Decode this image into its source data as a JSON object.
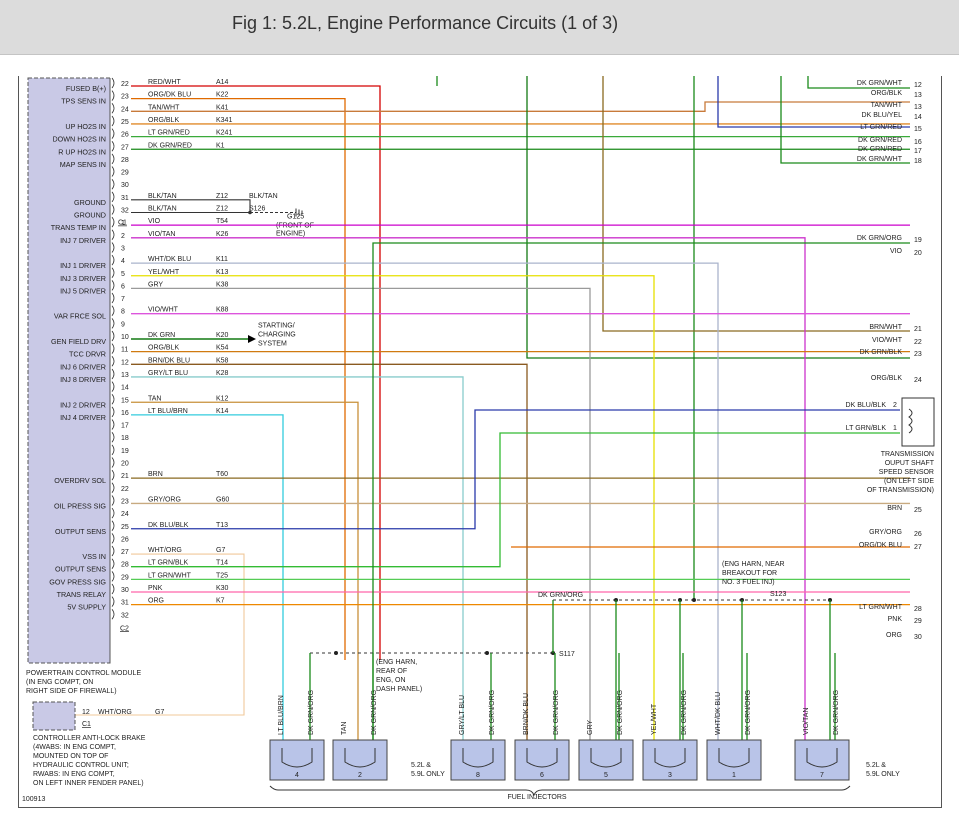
{
  "title": "Fig 1: 5.2L, Engine Performance Circuits (1 of 3)",
  "pcm": {
    "connector": "C2",
    "label_lines": [
      "POWERTRAIN CONTROL MODULE",
      "(IN ENG COMPT, ON",
      "RIGHT SIDE OF FIREWALL)"
    ],
    "functions": [
      {
        "name": "FUSED B(+)",
        "pin": 22
      },
      {
        "name": "TPS SENS IN",
        "pin": 23
      },
      {
        "name": "UP HO2S IN",
        "pin": 25
      },
      {
        "name": "DOWN HO2S IN",
        "pin": 26
      },
      {
        "name": "R UP HO2S IN",
        "pin": 27
      },
      {
        "name": "MAP SENS IN",
        "pin": 28
      },
      {
        "name": "GROUND",
        "pin": 31
      },
      {
        "name": "GROUND",
        "pin": 32
      },
      {
        "name": "TRANS TEMP IN",
        "pin": 1
      },
      {
        "name": "INJ 7 DRIVER",
        "pin": 2
      },
      {
        "name": "INJ 1 DRIVER",
        "pin": 4
      },
      {
        "name": "INJ 3 DRIVER",
        "pin": 5
      },
      {
        "name": "INJ 5 DRIVER",
        "pin": 6
      },
      {
        "name": "VAR FRCE SOL",
        "pin": 8
      },
      {
        "name": "GEN FIELD DRV",
        "pin": 10
      },
      {
        "name": "TCC DRVR",
        "pin": 11
      },
      {
        "name": "INJ 6 DRIVER",
        "pin": 12
      },
      {
        "name": "INJ 8 DRIVER",
        "pin": 13
      },
      {
        "name": "INJ 2 DRIVER",
        "pin": 15
      },
      {
        "name": "INJ 4 DRIVER",
        "pin": 16
      },
      {
        "name": "OVERDRV SOL",
        "pin": 21
      },
      {
        "name": "OIL PRESS SIG",
        "pin": 23
      },
      {
        "name": "OUTPUT SENS",
        "pin": 25
      },
      {
        "name": "VSS IN",
        "pin": 27
      },
      {
        "name": "OUTPUT SENS",
        "pin": 28
      },
      {
        "name": "GOV PRESS SIG",
        "pin": 29
      },
      {
        "name": "TRANS RELAY",
        "pin": 30
      },
      {
        "name": "5V SUPPLY",
        "pin": 31
      }
    ],
    "wires": [
      {
        "pin": "22",
        "color": "RED/WHT",
        "circuit": "A14",
        "stroke": "#d40000"
      },
      {
        "pin": "23",
        "color": "ORG/DK BLU",
        "circuit": "K22",
        "stroke": "#e06a00"
      },
      {
        "pin": "24",
        "color": "TAN/WHT",
        "circuit": "K41",
        "stroke": "#c87a3a"
      },
      {
        "pin": "25",
        "color": "ORG/BLK",
        "circuit": "K341",
        "stroke": "#e08a2a"
      },
      {
        "pin": "26",
        "color": "LT GRN/RED",
        "circuit": "K241",
        "stroke": "#3aaa3a"
      },
      {
        "pin": "27",
        "color": "DK GRN/RED",
        "circuit": "K1",
        "stroke": "#1a8a1a"
      },
      {
        "pin": "28",
        "color": "",
        "circuit": "",
        "stroke": ""
      },
      {
        "pin": "29",
        "color": "",
        "circuit": "",
        "stroke": ""
      },
      {
        "pin": "30",
        "color": "",
        "circuit": "",
        "stroke": ""
      },
      {
        "pin": "31",
        "color": "BLK/TAN",
        "circuit": "Z12",
        "stroke": "#333"
      },
      {
        "pin": "32",
        "color": "BLK/TAN",
        "circuit": "Z12",
        "stroke": "#333"
      },
      {
        "pin": "1",
        "color": "VIO",
        "circuit": "T54",
        "stroke": "#cc00cc"
      },
      {
        "pin": "2",
        "color": "VIO/TAN",
        "circuit": "K26",
        "stroke": "#cc33cc"
      },
      {
        "pin": "3",
        "color": "",
        "circuit": "",
        "stroke": ""
      },
      {
        "pin": "4",
        "color": "WHT/DK BLU",
        "circuit": "K11",
        "stroke": "#aab4cc"
      },
      {
        "pin": "5",
        "color": "YEL/WHT",
        "circuit": "K13",
        "stroke": "#e6e000"
      },
      {
        "pin": "6",
        "color": "GRY",
        "circuit": "K38",
        "stroke": "#9a9a9a"
      },
      {
        "pin": "7",
        "color": "",
        "circuit": "",
        "stroke": ""
      },
      {
        "pin": "8",
        "color": "VIO/WHT",
        "circuit": "K88",
        "stroke": "#dd55dd"
      },
      {
        "pin": "9",
        "color": "",
        "circuit": "",
        "stroke": ""
      },
      {
        "pin": "10",
        "color": "DK GRN",
        "circuit": "K20",
        "stroke": "#147a14"
      },
      {
        "pin": "11",
        "color": "ORG/BLK",
        "circuit": "K54",
        "stroke": "#d07a10"
      },
      {
        "pin": "12",
        "color": "BRN/DK BLU",
        "circuit": "K58",
        "stroke": "#8a5a20"
      },
      {
        "pin": "13",
        "color": "GRY/LT BLU",
        "circuit": "K28",
        "stroke": "#88cccc"
      },
      {
        "pin": "14",
        "color": "",
        "circuit": "",
        "stroke": ""
      },
      {
        "pin": "15",
        "color": "TAN",
        "circuit": "K12",
        "stroke": "#c8903a"
      },
      {
        "pin": "16",
        "color": "LT BLU/BRN",
        "circuit": "K14",
        "stroke": "#33ccdd"
      },
      {
        "pin": "17",
        "color": "",
        "circuit": "",
        "stroke": ""
      },
      {
        "pin": "18",
        "color": "",
        "circuit": "",
        "stroke": ""
      },
      {
        "pin": "19",
        "color": "",
        "circuit": "",
        "stroke": ""
      },
      {
        "pin": "20",
        "color": "",
        "circuit": "",
        "stroke": ""
      },
      {
        "pin": "21",
        "color": "BRN",
        "circuit": "T60",
        "stroke": "#8a6a20"
      },
      {
        "pin": "22",
        "color": "",
        "circuit": "",
        "stroke": ""
      },
      {
        "pin": "23",
        "color": "GRY/ORG",
        "circuit": "G60",
        "stroke": "#c8aa80"
      },
      {
        "pin": "24",
        "color": "",
        "circuit": "",
        "stroke": ""
      },
      {
        "pin": "25",
        "color": "DK BLU/BLK",
        "circuit": "T13",
        "stroke": "#2a3aaa"
      },
      {
        "pin": "26",
        "color": "",
        "circuit": "",
        "stroke": ""
      },
      {
        "pin": "27",
        "color": "WHT/ORG",
        "circuit": "G7",
        "stroke": "#f0c89a"
      },
      {
        "pin": "28",
        "color": "LT GRN/BLK",
        "circuit": "T14",
        "stroke": "#33bb33"
      },
      {
        "pin": "29",
        "color": "LT GRN/WHT",
        "circuit": "T25",
        "stroke": "#55cc55"
      },
      {
        "pin": "30",
        "color": "PNK",
        "circuit": "K30",
        "stroke": "#ff66aa"
      },
      {
        "pin": "31",
        "color": "ORG",
        "circuit": "K7",
        "stroke": "#ee8800"
      },
      {
        "pin": "32",
        "color": "",
        "circuit": "",
        "stroke": ""
      }
    ]
  },
  "connectors": {
    "c1": "C1",
    "c2": "C2"
  },
  "ground": {
    "wire": "BLK/TAN",
    "splice": "S126",
    "id": "G125",
    "note_lines": [
      "(FRONT OF",
      "ENGINE)"
    ]
  },
  "charging": {
    "label_lines": [
      "STARTING/",
      "CHARGING",
      "SYSTEM"
    ]
  },
  "right_wires": [
    {
      "pin": "12",
      "color": "DK GRN/WHT"
    },
    {
      "pin": "13",
      "color": "ORG/BLK"
    },
    {
      "pin": "13b",
      "color": "TAN/WHT"
    },
    {
      "pin": "14",
      "color": "DK BLU/YEL"
    },
    {
      "pin": "15",
      "color": "LT GRN/RED"
    },
    {
      "pin": "16",
      "color": "DK GRN/RED"
    },
    {
      "pin": "17",
      "color": "DK GRN/RED"
    },
    {
      "pin": "18",
      "color": "DK GRN/WHT"
    },
    {
      "pin": "19",
      "color": "DK GRN/ORG"
    },
    {
      "pin": "20",
      "color": "VIO"
    },
    {
      "pin": "21",
      "color": "BRN/WHT"
    },
    {
      "pin": "22",
      "color": "VIO/WHT"
    },
    {
      "pin": "23",
      "color": "DK GRN/BLK"
    },
    {
      "pin": "24",
      "color": "ORG/BLK"
    },
    {
      "pin": "25",
      "color": "BRN"
    },
    {
      "pin": "26",
      "color": "GRY/ORG"
    },
    {
      "pin": "27",
      "color": "ORG/DK BLU"
    },
    {
      "pin": "28",
      "color": "LT GRN/WHT"
    },
    {
      "pin": "29",
      "color": "PNK"
    },
    {
      "pin": "30",
      "color": "ORG"
    }
  ],
  "tos_sensor": {
    "wire_a": "DK BLU/BLK",
    "pin_a": "2",
    "wire_b": "LT GRN/BLK",
    "pin_b": "1",
    "label_lines": [
      "TRANSMISSION",
      "OUPUT SHAFT",
      "SPEED SENSOR",
      "(ON LEFT SIDE",
      "OF TRANSMISSION)"
    ]
  },
  "splice_s123": {
    "id": "S123",
    "wire": "DK GRN/ORG",
    "note_lines": [
      "(ENG HARN, NEAR",
      "BREAKOUT FOR",
      "NO. 3 FUEL INJ)"
    ]
  },
  "splice_s117": {
    "id": "S117",
    "note_lines": [
      "(ENG HARN,",
      "REAR OF",
      "ENG, ON",
      "DASH PANEL)"
    ]
  },
  "abs": {
    "pin": "12",
    "wire": "WHT/ORG",
    "circuit": "G7",
    "connector": "C1",
    "label_lines": [
      "CONTROLLER ANTI-LOCK BRAKE",
      "(4WABS: IN ENG COMPT,",
      "MOUNTED ON TOP OF",
      "HYDRAULIC CONTROL UNIT;",
      "RWABS: IN ENG COMPT,",
      "ON LEFT INNER FENDER PANEL)"
    ]
  },
  "injectors": [
    {
      "num": "4",
      "left": "LT BLU/BRN",
      "right": "DK GRN/ORG"
    },
    {
      "num": "2",
      "left": "TAN",
      "right": "DK GRN/ORG"
    },
    {
      "num": "8",
      "left": "GRY/LT BLU",
      "right": "DK GRN/ORG"
    },
    {
      "num": "6",
      "left": "BRN/DK BLU",
      "right": "DK GRN/ORG"
    },
    {
      "num": "5",
      "left": "GRY",
      "right": "DK GRN/ORG"
    },
    {
      "num": "3",
      "left": "YEL/WHT",
      "right": "DK GRN/ORG"
    },
    {
      "num": "1",
      "left": "WHT/DK BLU",
      "right": "DK GRN/ORG"
    },
    {
      "num": "7",
      "left": "VIO/TAN",
      "right": "DK GRN/ORG"
    }
  ],
  "injector_notes": {
    "left_lines": [
      "5.2L &",
      "5.9L ONLY"
    ],
    "right_lines": [
      "5.2L &",
      "5.9L ONLY"
    ],
    "group": "FUEL INJECTORS"
  },
  "figure_id": "100913"
}
